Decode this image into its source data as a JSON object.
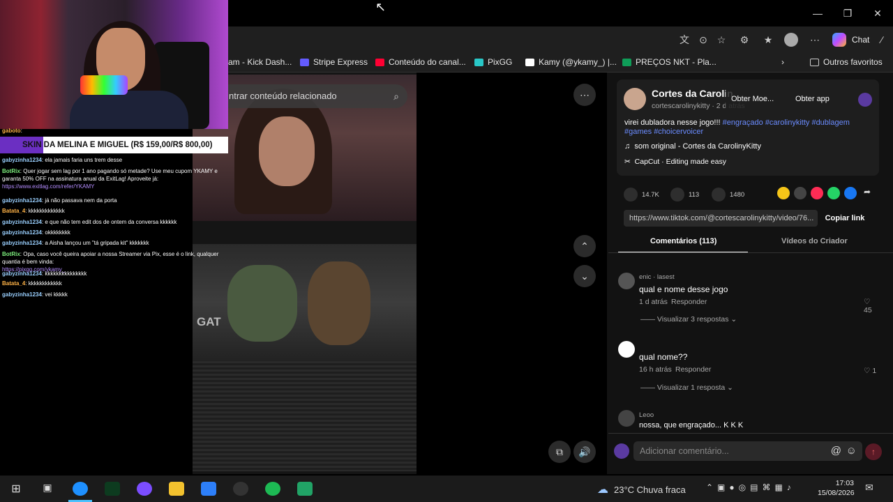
{
  "browser": {
    "chat_label": "Chat",
    "bookmarks": [
      "am - Kick Dash...",
      "Stripe Express",
      "Conteúdo do canal...",
      "PixGG",
      "Kamy (@ykamy_) |...",
      "PREÇOS NKT - Pla...",
      "Outros favoritos"
    ],
    "bookmark_colors": [
      "#53fc18",
      "#635bff",
      "#ff0033",
      "#29c7c7",
      "#ffffff",
      "#0f9d58",
      "#cccccc"
    ]
  },
  "overlay": {
    "skin_label": "SKIN DA MELINA E MIGUEL (R$ 159,00/R$ 800,00)",
    "chat": [
      {
        "user": "gaboto",
        "text": ":",
        "color": "o"
      },
      {
        "user": "gabyzinha1234",
        "text": ": ela jamais faria uns trem desse",
        "color": "b"
      },
      {
        "user": "BotRix",
        "text": ": Quer jogar sem lag por 1 ano pagando só metade? Use meu cupom YKAMY e garanta 50% OFF na assinatura anual da ExitLag! Aproveite já:",
        "link": "https://www.exitlag.com/refer/YKAMY",
        "color": "g"
      },
      {
        "user": "gabyzinha1234",
        "text": ": já não passava nem da porta",
        "color": "b"
      },
      {
        "user": "Batata_4",
        "text": ": kkkkkkkkkkkkk",
        "color": "o"
      },
      {
        "user": "gabyzinha1234",
        "text": ": e que não tem edit dos de ontem da conversa kkkkkk",
        "color": "b"
      },
      {
        "user": "gabyzinha1234",
        "text": ": okkkkkkkk",
        "color": "b"
      },
      {
        "user": "gabyzinha1234",
        "text": ": a Aisha lançou um \"tá gripada kit\" kkkkkkk",
        "color": "b"
      },
      {
        "user": "BotRix",
        "text": ": Opa, caso você queira apoiar a nossa Streamer via Pix, esse é o link, qualquer quantia é bem vinda:",
        "link": "https://pixgg.com/ykamy_",
        "color": "g"
      },
      {
        "user": "gabyzinha1234",
        "text": ": kkkkkkkkkkkkkkk",
        "color": "b"
      },
      {
        "user": "Batata_4",
        "text": ": kkkkkkkkkkkk",
        "color": "o"
      },
      {
        "user": "gabyzinha1234",
        "text": ": vei kkkkk",
        "color": "b"
      }
    ]
  },
  "video": {
    "search_placeholder": "ntrar conteúdo relacionado",
    "gate_text": "GAT"
  },
  "panel": {
    "creator_name": "Cortes da Carolin",
    "creator_handle": "cortescarolinykitty · 2 d atrás",
    "obter_moe": "Obter Moe...",
    "obter_app": "Obter app",
    "caption_text": "virei dubladora nesse jogo!!!",
    "caption_tags": "#engraçado #carolinykitty #dublagem",
    "caption_tags2": "#games #choicervoicer",
    "sound": "som original - Cortes da CarolinyKitty",
    "capcut": "CapCut · Editing made easy",
    "likes": "14.7K",
    "comments_count": "113",
    "saves": "1480",
    "link": "https://www.tiktok.com/@cortescarolinykitty/video/76...",
    "copy_link": "Copiar link",
    "tab_comments": "Comentários (113)",
    "tab_creator": "Vídeos do Criador",
    "comments": [
      {
        "user": "enic · lasest",
        "text": "qual e nome desse jogo",
        "time": "1 d atrás",
        "reply": "Responder",
        "likes": "45",
        "view_replies": "Visualizar 3 respostas"
      },
      {
        "user": "",
        "text": "qual nome??",
        "time": "16 h atrás",
        "reply": "Responder",
        "likes": "1",
        "view_replies": "Visualizar 1 resposta"
      },
      {
        "user": "Leoo",
        "text": "nossa, que engraçado... K K K"
      }
    ],
    "comment_placeholder": "Adicionar comentário..."
  },
  "taskbar": {
    "weather": "23°C  Chuva fraca",
    "time": "17:03",
    "date": "15/08/2026"
  }
}
